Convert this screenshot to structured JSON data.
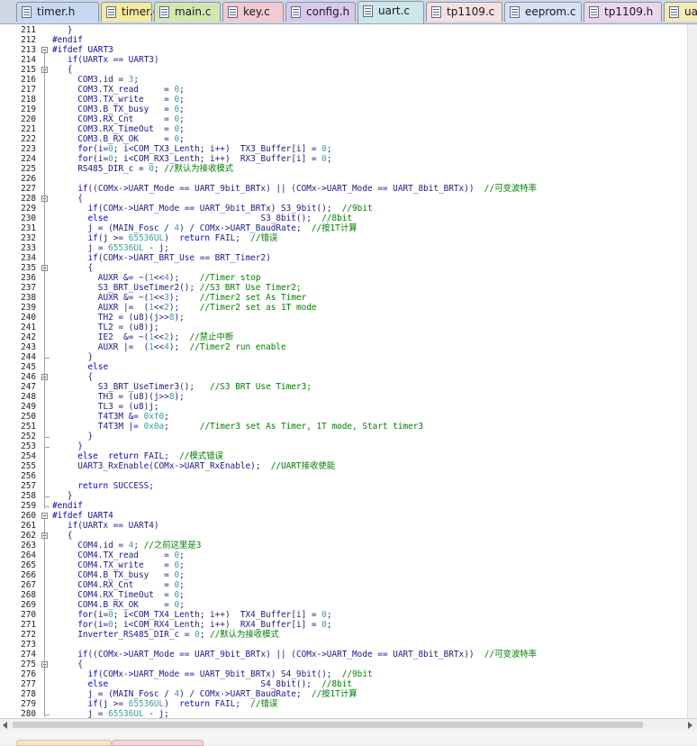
{
  "tabs": [
    {
      "label": "timer.h",
      "color": "#c7d9f2",
      "active": false
    },
    {
      "label": "timer.c",
      "color": "#f6eaa0",
      "active": false
    },
    {
      "label": "main.c",
      "color": "#d3e8b0",
      "active": false
    },
    {
      "label": "key.c",
      "color": "#f3c9d4",
      "active": false
    },
    {
      "label": "config.h",
      "color": "#d8c8ec",
      "active": false
    },
    {
      "label": "uart.c",
      "color": "#cde6e8",
      "active": true
    },
    {
      "label": "tp1109.c",
      "color": "#f4e0e0",
      "active": false
    },
    {
      "label": "eeprom.c",
      "color": "#d6e2f4",
      "active": false
    },
    {
      "label": "tp1109.h",
      "color": "#ecd6ec",
      "active": false
    },
    {
      "label": "uar",
      "color": "#f4eab8",
      "active": false
    }
  ],
  "code": [
    {
      "n": "211",
      "t": "   }"
    },
    {
      "n": "212",
      "t": "#endif"
    },
    {
      "n": "213",
      "t": "#ifdef UART3"
    },
    {
      "n": "214",
      "t": "   if(UARTx == UART3)"
    },
    {
      "n": "215",
      "t": "   {"
    },
    {
      "n": "216",
      "t": "     COM3.id = 3;"
    },
    {
      "n": "217",
      "t": "     COM3.TX_read     = 0;"
    },
    {
      "n": "218",
      "t": "     COM3.TX_write    = 0;"
    },
    {
      "n": "219",
      "t": "     COM3.B_TX_busy   = 0;"
    },
    {
      "n": "220",
      "t": "     COM3.RX_Cnt      = 0;"
    },
    {
      "n": "221",
      "t": "     COM3.RX_TimeOut  = 0;"
    },
    {
      "n": "222",
      "t": "     COM3.B_RX_OK     = 0;"
    },
    {
      "n": "223",
      "t": "     for(i=0; i<COM_TX3_Lenth; i++)  TX3_Buffer[i] = 0;"
    },
    {
      "n": "224",
      "t": "     for(i=0; i<COM_RX3_Lenth; i++)  RX3_Buffer[i] = 0;"
    },
    {
      "n": "225",
      "t": "     RS485_DIR_c = 0; //默认为接收模式"
    },
    {
      "n": "226",
      "t": ""
    },
    {
      "n": "227",
      "t": "     if((COMx->UART_Mode == UART_9bit_BRTx) || (COMx->UART_Mode == UART_8bit_BRTx))  //可变波特率"
    },
    {
      "n": "228",
      "t": "     {"
    },
    {
      "n": "229",
      "t": "       if(COMx->UART_Mode == UART_9bit_BRTx) S3_9bit();  //9bit"
    },
    {
      "n": "230",
      "t": "       else                              S3_8bit();  //8bit"
    },
    {
      "n": "231",
      "t": "       j = (MAIN_Fosc / 4) / COMx->UART_BaudRate;  //按1T计算"
    },
    {
      "n": "232",
      "t": "       if(j >= 65536UL)  return FAIL;  //错误"
    },
    {
      "n": "233",
      "t": "       j = 65536UL - j;"
    },
    {
      "n": "234",
      "t": "       if(COMx->UART_BRT_Use == BRT_Timer2)"
    },
    {
      "n": "235",
      "t": "       {"
    },
    {
      "n": "236",
      "t": "         AUXR &= ~(1<<4);    //Timer stop"
    },
    {
      "n": "237",
      "t": "         S3_BRT_UseTimer2(); //S3 BRT Use Timer2;"
    },
    {
      "n": "238",
      "t": "         AUXR &= ~(1<<3);    //Timer2 set As Timer"
    },
    {
      "n": "239",
      "t": "         AUXR |=  (1<<2);    //Timer2 set as 1T mode"
    },
    {
      "n": "240",
      "t": "         TH2 = (u8)(j>>8);"
    },
    {
      "n": "241",
      "t": "         TL2 = (u8)j;"
    },
    {
      "n": "242",
      "t": "         IE2  &= ~(1<<2);  //禁止中断"
    },
    {
      "n": "243",
      "t": "         AUXR |=  (1<<4);  //Timer2 run enable"
    },
    {
      "n": "244",
      "t": "       }"
    },
    {
      "n": "245",
      "t": "       else"
    },
    {
      "n": "246",
      "t": "       {"
    },
    {
      "n": "247",
      "t": "         S3_BRT_UseTimer3();   //S3 BRT Use Timer3;"
    },
    {
      "n": "248",
      "t": "         TH3 = (u8)(j>>8);"
    },
    {
      "n": "249",
      "t": "         TL3 = (u8)j;"
    },
    {
      "n": "250",
      "t": "         T4T3M &= 0xf0;"
    },
    {
      "n": "251",
      "t": "         T4T3M |= 0x0a;      //Timer3 set As Timer, 1T mode, Start timer3"
    },
    {
      "n": "252",
      "t": "       }"
    },
    {
      "n": "253",
      "t": "     }"
    },
    {
      "n": "254",
      "t": "     else  return FAIL;  //模式错误"
    },
    {
      "n": "255",
      "t": "     UART3_RxEnable(COMx->UART_RxEnable);  //UART接收使能"
    },
    {
      "n": "256",
      "t": ""
    },
    {
      "n": "257",
      "t": "     return SUCCESS;"
    },
    {
      "n": "258",
      "t": "   }"
    },
    {
      "n": "259",
      "t": "#endif"
    },
    {
      "n": "260",
      "t": "#ifdef UART4"
    },
    {
      "n": "261",
      "t": "   if(UARTx == UART4)"
    },
    {
      "n": "262",
      "t": "   {"
    },
    {
      "n": "263",
      "t": "     COM4.id = 4; //之前这里是3"
    },
    {
      "n": "264",
      "t": "     COM4.TX_read     = 0;"
    },
    {
      "n": "265",
      "t": "     COM4.TX_write    = 0;"
    },
    {
      "n": "266",
      "t": "     COM4.B_TX_busy   = 0;"
    },
    {
      "n": "267",
      "t": "     COM4.RX_Cnt      = 0;"
    },
    {
      "n": "268",
      "t": "     COM4.RX_TimeOut  = 0;"
    },
    {
      "n": "269",
      "t": "     COM4.B_RX_OK     = 0;"
    },
    {
      "n": "270",
      "t": "     for(i=0; i<COM_TX4_Lenth; i++)  TX4_Buffer[i] = 0;"
    },
    {
      "n": "271",
      "t": "     for(i=0; i<COM_RX4_Lenth; i++)  RX4_Buffer[i] = 0;"
    },
    {
      "n": "272",
      "t": "     Inverter_RS485_DIR_c = 0; //默认为接收模式"
    },
    {
      "n": "273",
      "t": ""
    },
    {
      "n": "274",
      "t": "     if((COMx->UART_Mode == UART_9bit_BRTx) || (COMx->UART_Mode == UART_8bit_BRTx))  //可变波特率"
    },
    {
      "n": "275",
      "t": "     {"
    },
    {
      "n": "276",
      "t": "       if(COMx->UART_Mode == UART_9bit_BRTx) S4_9bit();  //9bit"
    },
    {
      "n": "277",
      "t": "       else                              S4_8bit();  //8bit"
    },
    {
      "n": "278",
      "t": "       j = (MAIN_Fosc / 4) / COMx->UART_BaudRate;  //按1T计算"
    },
    {
      "n": "279",
      "t": "       if(j >= 65536UL)  return FAIL;  //错误"
    },
    {
      "n": "280",
      "t": "       j = 65536UL - j;"
    }
  ],
  "colors": {
    "keyword": "#0000ff",
    "number": "#3a9d9d",
    "comment": "#008000",
    "preprocessor": "#0a0aa8",
    "text": "#1a1a8c"
  }
}
